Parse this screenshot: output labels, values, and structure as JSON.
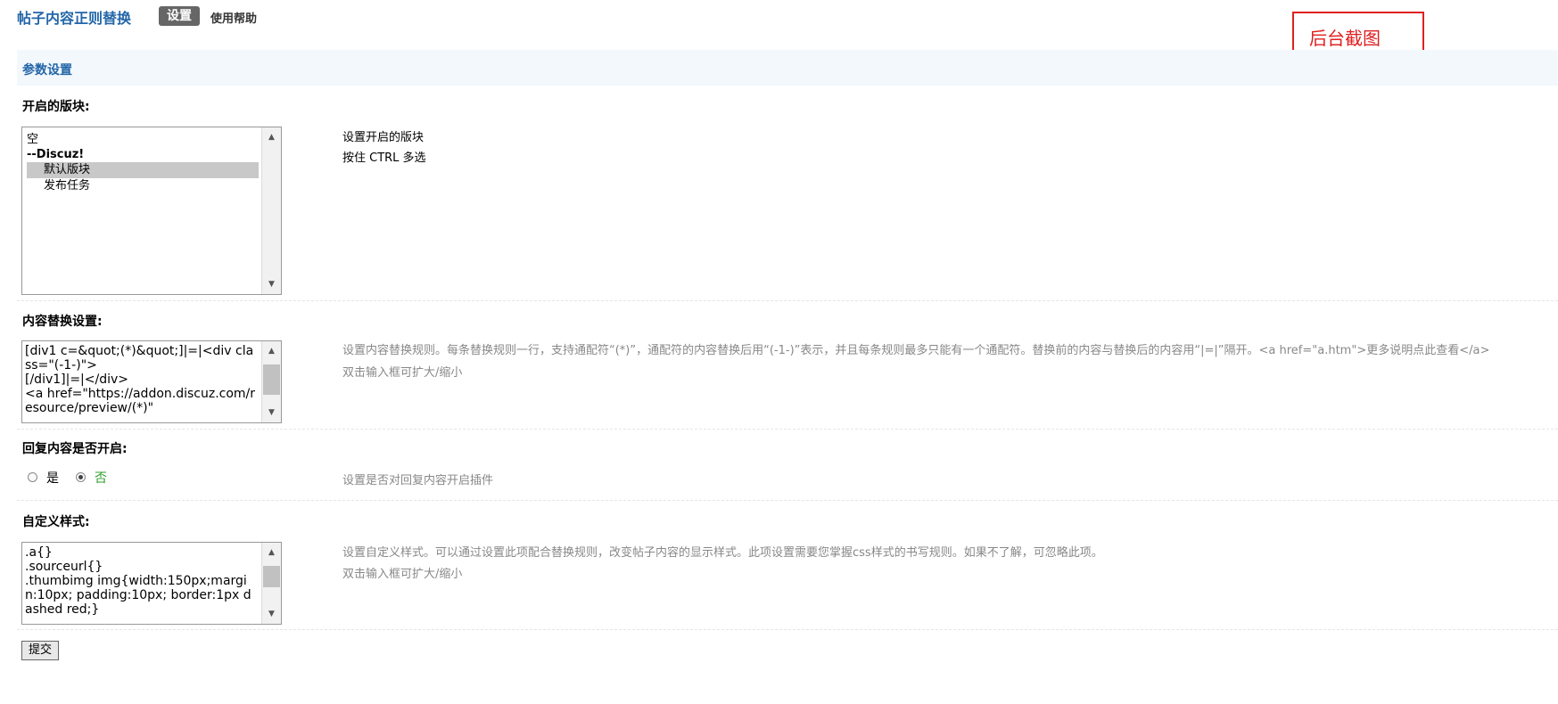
{
  "header": {
    "plugin_title": "帖子内容正则替换",
    "tab_settings": "设置",
    "tab_help": "使用帮助"
  },
  "annotation": {
    "text": "后台截图"
  },
  "section": {
    "title": "参数设置"
  },
  "fields": {
    "boards": {
      "label": "开启的版块:",
      "options": [
        {
          "label": "空",
          "bold": false,
          "selected": false,
          "indent": 0
        },
        {
          "label": "--Discuz!",
          "bold": true,
          "selected": false,
          "indent": 0
        },
        {
          "label": "默认版块",
          "bold": false,
          "selected": true,
          "indent": 1
        },
        {
          "label": "发布任务",
          "bold": false,
          "selected": false,
          "indent": 1
        }
      ],
      "hint_line1": "设置开启的版块",
      "hint_line2": "按住 CTRL 多选"
    },
    "replace_rules": {
      "label": "内容替换设置:",
      "value": "[div1 c=&quot;(*)&quot;]|=|<div class=\"(-1-)\">\n[/div1]|=|</div>\n<a href=\"https://addon.discuz.com/resource/preview/(*)\"",
      "hint": "设置内容替换规则。每条替换规则一行，支持通配符“(*)”，通配符的内容替换后用“(-1-)”表示，并且每条规则最多只能有一个通配符。替换前的内容与替换后的内容用“|=|”隔开。<a href=\"a.htm\">更多说明点此查看</a>",
      "hint2": "双击输入框可扩大/缩小"
    },
    "reply_enabled": {
      "label": "回复内容是否开启:",
      "option_yes": "是",
      "option_no": "否",
      "selected": "否",
      "hint": "设置是否对回复内容开启插件"
    },
    "custom_style": {
      "label": "自定义样式:",
      "value": ".a{}\n.sourceurl{}\n.thumbimg img{width:150px;margin:10px; padding:10px; border:1px dashed red;}",
      "hint": "设置自定义样式。可以通过设置此项配合替换规则，改变帖子内容的显示样式。此项设置需要您掌握css样式的书写规则。如果不了解，可忽略此项。",
      "hint2": "双击输入框可扩大/缩小"
    }
  },
  "submit": {
    "label": "提交"
  },
  "colors": {
    "link_blue": "#2366a8",
    "annotation_red": "#e02020",
    "radio_green": "#2e9d2e"
  }
}
